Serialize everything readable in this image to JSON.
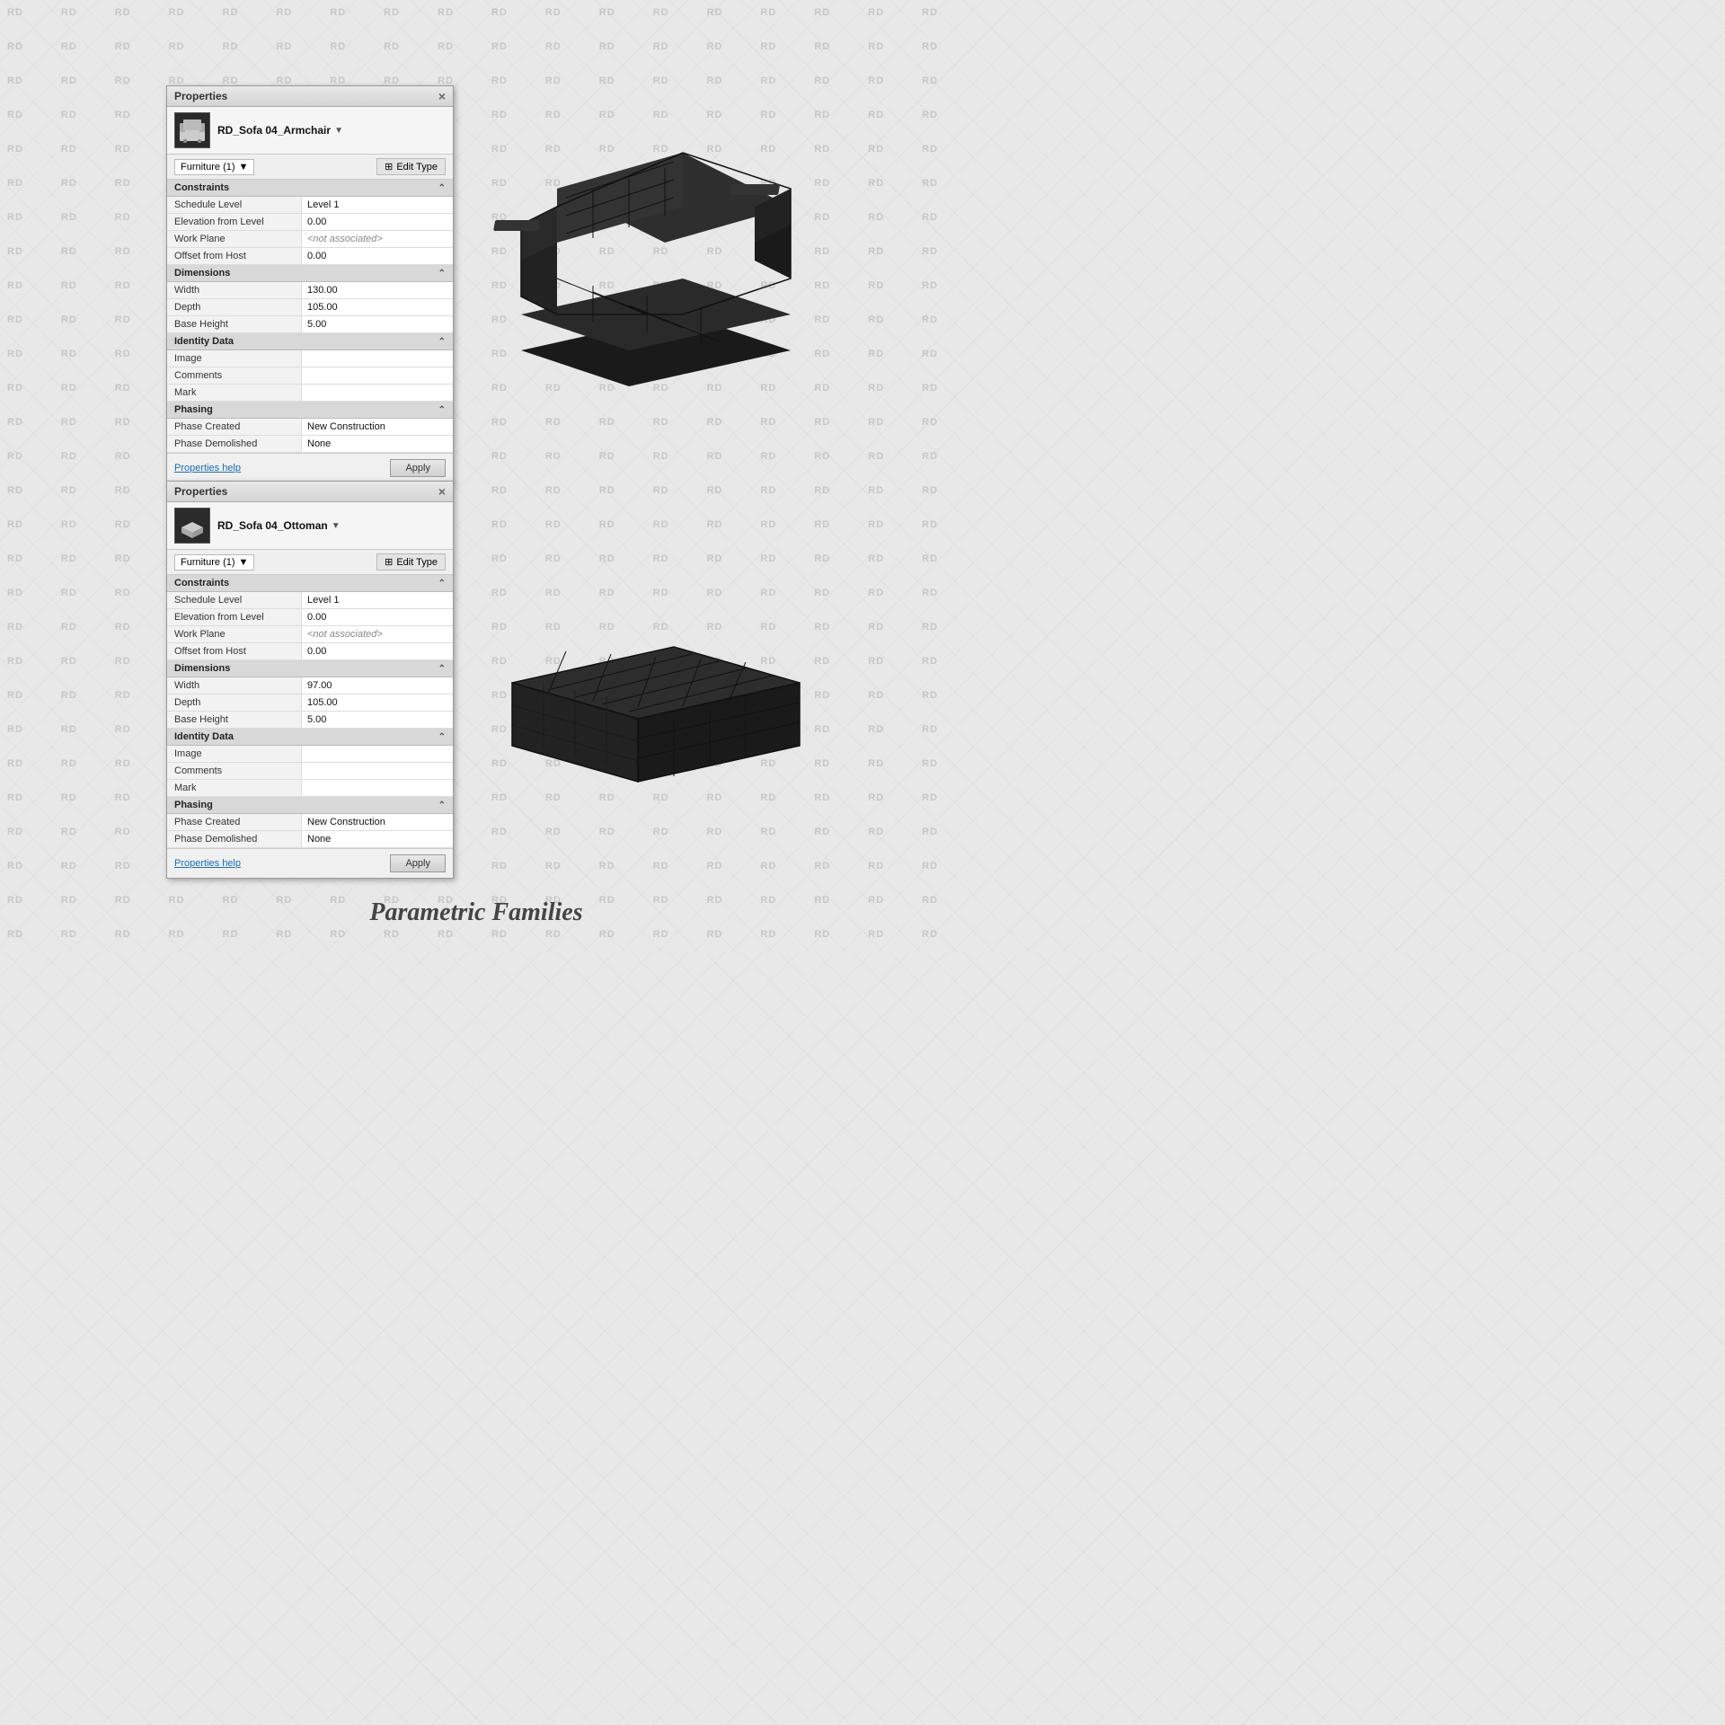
{
  "background": {
    "watermark": "RD"
  },
  "panel1": {
    "title": "Properties",
    "close_label": "×",
    "item_name": "RD_Sofa 04_Armchair",
    "type_selector": "Furniture (1)",
    "edit_type": "Edit Type",
    "sections": [
      {
        "name": "Constraints",
        "rows": [
          {
            "label": "Schedule Level",
            "value": "Level 1",
            "grey": false
          },
          {
            "label": "Elevation from Level",
            "value": "0.00",
            "grey": false
          },
          {
            "label": "Work Plane",
            "value": "<not associated>",
            "grey": true
          },
          {
            "label": "Offset from Host",
            "value": "0.00",
            "grey": false
          }
        ]
      },
      {
        "name": "Dimensions",
        "rows": [
          {
            "label": "Width",
            "value": "130.00",
            "grey": false
          },
          {
            "label": "Depth",
            "value": "105.00",
            "grey": false
          },
          {
            "label": "Base Height",
            "value": "5.00",
            "grey": false
          }
        ]
      },
      {
        "name": "Identity Data",
        "rows": [
          {
            "label": "Image",
            "value": "",
            "grey": false
          },
          {
            "label": "Comments",
            "value": "",
            "grey": false
          },
          {
            "label": "Mark",
            "value": "",
            "grey": false
          }
        ]
      },
      {
        "name": "Phasing",
        "rows": [
          {
            "label": "Phase Created",
            "value": "New Construction",
            "grey": false
          },
          {
            "label": "Phase Demolished",
            "value": "None",
            "grey": false
          }
        ]
      }
    ],
    "footer": {
      "help_link": "Properties help",
      "apply_btn": "Apply"
    }
  },
  "panel2": {
    "title": "Properties",
    "close_label": "×",
    "item_name": "RD_Sofa 04_Ottoman",
    "type_selector": "Furniture (1)",
    "edit_type": "Edit Type",
    "sections": [
      {
        "name": "Constraints",
        "rows": [
          {
            "label": "Schedule Level",
            "value": "Level 1",
            "grey": false
          },
          {
            "label": "Elevation from Level",
            "value": "0.00",
            "grey": false
          },
          {
            "label": "Work Plane",
            "value": "<not associated>",
            "grey": true
          },
          {
            "label": "Offset from Host",
            "value": "0.00",
            "grey": false
          }
        ]
      },
      {
        "name": "Dimensions",
        "rows": [
          {
            "label": "Width",
            "value": "97.00",
            "grey": false
          },
          {
            "label": "Depth",
            "value": "105.00",
            "grey": false
          },
          {
            "label": "Base Height",
            "value": "5.00",
            "grey": false
          }
        ]
      },
      {
        "name": "Identity Data",
        "rows": [
          {
            "label": "Image",
            "value": "",
            "grey": false
          },
          {
            "label": "Comments",
            "value": "",
            "grey": false
          },
          {
            "label": "Mark",
            "value": "",
            "grey": false
          }
        ]
      },
      {
        "name": "Phasing",
        "rows": [
          {
            "label": "Phase Created",
            "value": "New Construction",
            "grey": false
          },
          {
            "label": "Phase Demolished",
            "value": "None",
            "grey": false
          }
        ]
      }
    ],
    "footer": {
      "help_link": "Properties help",
      "apply_btn": "Apply"
    }
  },
  "page_title": "Parametric Families"
}
